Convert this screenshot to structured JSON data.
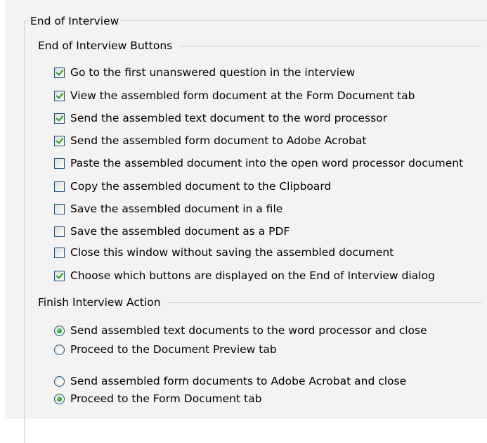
{
  "group": {
    "title": "End of Interview"
  },
  "buttons_section": {
    "title": "End of Interview Buttons",
    "items": [
      {
        "label": "Go to the first unanswered question in the interview",
        "checked": true
      },
      {
        "label": "View the assembled form document at the Form Document tab",
        "checked": true
      },
      {
        "label": "Send the assembled text document to the word processor",
        "checked": true
      },
      {
        "label": "Send the assembled form document to Adobe Acrobat",
        "checked": true
      },
      {
        "label": "Paste the assembled document into the open word processor document",
        "checked": false
      },
      {
        "label": "Copy the assembled document to the Clipboard",
        "checked": false
      },
      {
        "label": "Save the assembled document in a file",
        "checked": false
      },
      {
        "label": "Save the assembled document as a PDF",
        "checked": false
      },
      {
        "label": "Close this window without saving the assembled document",
        "checked": false
      },
      {
        "label": "Choose which buttons are displayed on the End of Interview dialog",
        "checked": true
      }
    ]
  },
  "finish_section": {
    "title": "Finish Interview Action",
    "text_group": [
      {
        "label": "Send assembled text documents to the word processor and close",
        "selected": true
      },
      {
        "label": "Proceed to the Document Preview tab",
        "selected": false
      }
    ],
    "form_group": [
      {
        "label": "Send assembled form documents to Adobe Acrobat and close",
        "selected": false
      },
      {
        "label": "Proceed to the Form Document tab",
        "selected": true
      }
    ]
  },
  "colors": {
    "panel_background": "#f3f3f3",
    "check_mark": "#21a121",
    "control_border": "#1c5180",
    "group_border": "#d0d0bf"
  }
}
